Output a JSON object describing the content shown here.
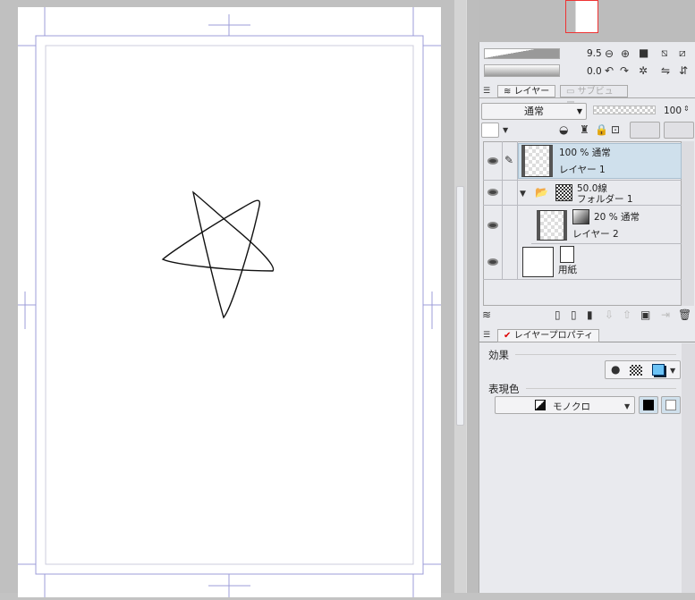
{
  "navigator": {
    "zoom": "9.5",
    "rotation": "0.0"
  },
  "layer_panel": {
    "tabs": [
      {
        "label": "レイヤー"
      },
      {
        "label": "サブビュー"
      }
    ],
    "blend_mode": "通常",
    "opacity": "100",
    "layers": [
      {
        "opacity_mode": "100 % 通常",
        "name": "レイヤー 1",
        "selected": true
      },
      {
        "opacity_mode": "50.0線",
        "name": "フォルダー 1"
      },
      {
        "opacity_mode": "20 % 通常",
        "name": "レイヤー 2"
      },
      {
        "name": "用紙"
      }
    ]
  },
  "property_panel": {
    "tab": "レイヤープロパティ",
    "effect_label": "効果",
    "expression_color_label": "表現色",
    "expression_color_value": "モノクロ"
  },
  "colors": {
    "accent_selected": "#cfe0ec",
    "guide": "#9c9cd8"
  }
}
